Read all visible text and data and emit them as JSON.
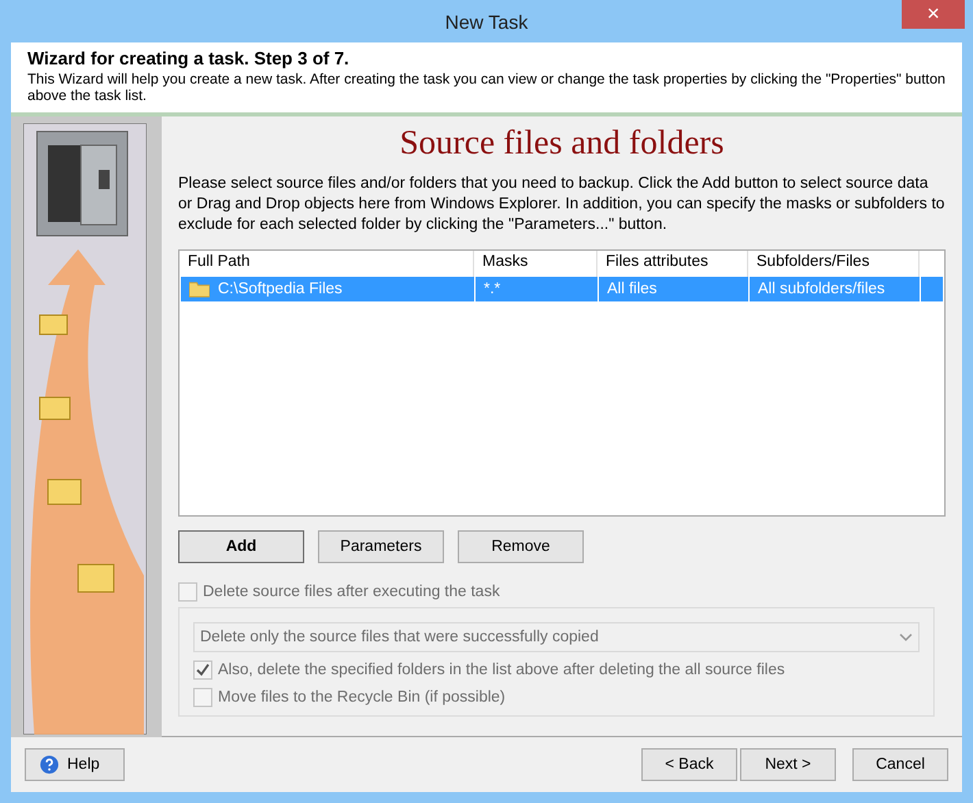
{
  "window": {
    "title": "New Task",
    "close": "×"
  },
  "header": {
    "title": "Wizard for creating a task. Step 3 of 7.",
    "description": "This Wizard will help you create a new task. After creating the task you can view or change the task properties by clicking the \"Properties\" button above the task list."
  },
  "page": {
    "title": "Source files and folders",
    "description": "Please select source files and/or folders that you need to backup. Click the Add button to select source data or Drag and Drop objects here from Windows Explorer. In addition, you can specify the masks or subfolders to exclude for each selected folder by clicking the \"Parameters...\" button."
  },
  "table": {
    "columns": [
      "Full Path",
      "Masks",
      "Files attributes",
      "Subfolders/Files"
    ],
    "rows": [
      {
        "cells": [
          "C:\\Softpedia Files",
          "*.*",
          "All files",
          "All subfolders/files"
        ],
        "selected": true
      }
    ]
  },
  "list_buttons": [
    {
      "label": "Add",
      "default": true
    },
    {
      "label": "Parameters",
      "default": false
    },
    {
      "label": "Remove",
      "default": false
    }
  ],
  "delete_option": {
    "label": "Delete source files after executing the task",
    "checked": false,
    "disabled": true
  },
  "delete_group": {
    "disabled": true,
    "dropdown": {
      "value": "Delete only the source files that were successfully copied"
    },
    "options": [
      {
        "label": "Also, delete the specified folders in the list above after deleting the all source files",
        "checked": true
      },
      {
        "label": "Move files to the Recycle Bin (if possible)",
        "checked": false
      }
    ]
  },
  "footer": {
    "help": "Help",
    "back": "< Back",
    "next": "Next >",
    "cancel": "Cancel"
  }
}
